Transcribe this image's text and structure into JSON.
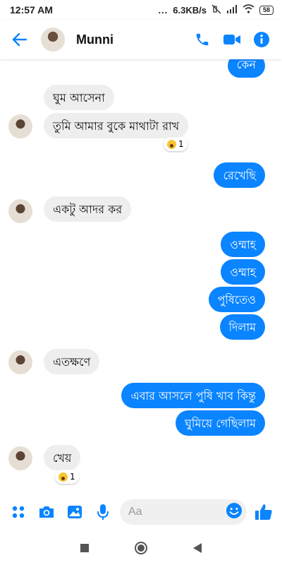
{
  "status_bar": {
    "time": "12:57 AM",
    "dots": "...",
    "network_speed": "6.3KB/s",
    "battery": "58"
  },
  "header": {
    "contact_name": "Munni",
    "icons": [
      "back-arrow-icon",
      "phone-icon",
      "video-camera-icon",
      "info-icon"
    ]
  },
  "accent_color": "#0a84ff",
  "messages": [
    {
      "direction": "outgoing",
      "text": "কেন"
    },
    {
      "direction": "incoming",
      "text": "ঘুম আসেনা"
    },
    {
      "direction": "incoming",
      "text": "তুমি আমার বুকে মাথাটা রাখ",
      "reaction": {
        "emoji": "wow",
        "count": "1"
      }
    },
    {
      "direction": "outgoing",
      "text": "রেখেছি"
    },
    {
      "direction": "incoming",
      "text": "একটু আদর কর"
    },
    {
      "direction": "outgoing",
      "text": "ওম্মাহ"
    },
    {
      "direction": "outgoing",
      "text": "ওম্মাহ"
    },
    {
      "direction": "outgoing",
      "text": "পুষিতেও"
    },
    {
      "direction": "outgoing",
      "text": "দিলাম"
    },
    {
      "direction": "incoming",
      "text": "এতক্ষণে"
    },
    {
      "direction": "outgoing",
      "text": "এবার আসলে পুষি খাব কিন্তু"
    },
    {
      "direction": "outgoing",
      "text": "ঘুমিয়ে গেছিলাম"
    },
    {
      "direction": "incoming",
      "text": "খেয়",
      "reaction": {
        "emoji": "wow",
        "count": "1"
      }
    }
  ],
  "composer": {
    "placeholder": "Aa",
    "icons": [
      "apps-icon",
      "camera-icon",
      "image-icon",
      "microphone-icon",
      "emoji-icon",
      "thumbs-up-icon"
    ]
  },
  "nav_bar": {
    "icons": [
      "recents-square-icon",
      "home-circle-icon",
      "back-triangle-icon"
    ]
  }
}
